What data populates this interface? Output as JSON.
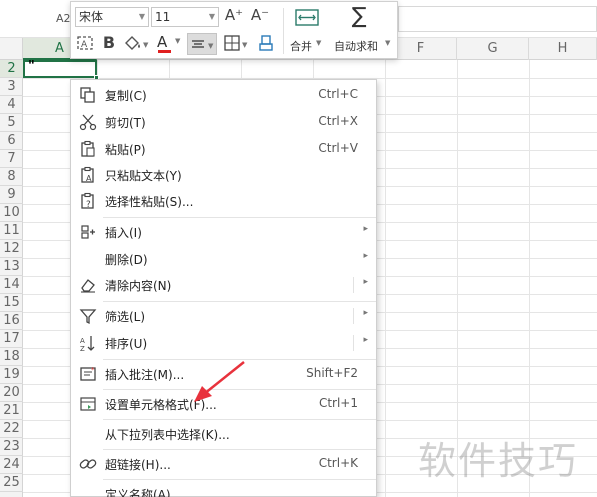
{
  "formula": {
    "name_box": "A2"
  },
  "columns": [
    "A",
    "B",
    "C",
    "D",
    "E",
    "F",
    "G",
    "H"
  ],
  "rows": [
    "2",
    "3",
    "4",
    "5",
    "6",
    "7",
    "8",
    "9",
    "10",
    "11",
    "12",
    "13",
    "14",
    "15",
    "16",
    "17",
    "18",
    "19",
    "20",
    "21",
    "22",
    "23",
    "24",
    "25"
  ],
  "cell_a2": "\"",
  "toolbar": {
    "font": "宋体",
    "size": "11",
    "increase_font": "A⁺",
    "decrease_font": "A⁻",
    "bold": "B",
    "font_color": "A",
    "merge_label": "合并",
    "autosum_label": "自动求和"
  },
  "menu": [
    {
      "key": "copy",
      "label": "复制(C)",
      "shortcut": "Ctrl+C"
    },
    {
      "key": "cut",
      "label": "剪切(T)",
      "shortcut": "Ctrl+X"
    },
    {
      "key": "paste",
      "label": "粘贴(P)",
      "shortcut": "Ctrl+V"
    },
    {
      "key": "paste-text",
      "label": "只粘贴文本(Y)",
      "shortcut": ""
    },
    {
      "key": "paste-special",
      "label": "选择性粘贴(S)...",
      "shortcut": ""
    },
    {
      "key": "insert",
      "label": "插入(I)",
      "shortcut": ""
    },
    {
      "key": "delete",
      "label": "删除(D)",
      "shortcut": ""
    },
    {
      "key": "clear",
      "label": "清除内容(N)",
      "shortcut": ""
    },
    {
      "key": "filter",
      "label": "筛选(L)",
      "shortcut": ""
    },
    {
      "key": "sort",
      "label": "排序(U)",
      "shortcut": ""
    },
    {
      "key": "insert-comment",
      "label": "插入批注(M)...",
      "shortcut": "Shift+F2"
    },
    {
      "key": "format-cells",
      "label": "设置单元格格式(F)...",
      "shortcut": "Ctrl+1"
    },
    {
      "key": "pick-list",
      "label": "从下拉列表中选择(K)...",
      "shortcut": ""
    },
    {
      "key": "hyperlink",
      "label": "超链接(H)...",
      "shortcut": "Ctrl+K"
    },
    {
      "key": "define-name",
      "label": "定义名称(A)...",
      "shortcut": ""
    }
  ],
  "watermark": "软件技巧",
  "colors": {
    "accent": "#217346",
    "font_color": "#e02020",
    "arrow": "#e8323c"
  }
}
